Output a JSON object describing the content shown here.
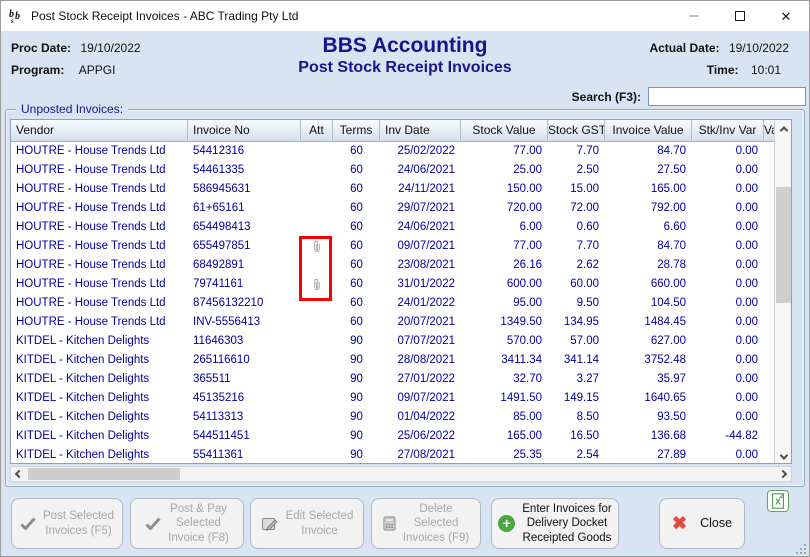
{
  "window": {
    "title": "Post Stock Receipt Invoices - ABC Trading Pty Ltd"
  },
  "header": {
    "proc_date_label": "Proc Date:",
    "proc_date": "19/10/2022",
    "program_label": "Program:",
    "program": "APPGI",
    "app_title": "BBS Accounting",
    "screen_title": "Post Stock Receipt Invoices",
    "actual_date_label": "Actual Date:",
    "actual_date": "19/10/2022",
    "time_label": "Time:",
    "time": "10:01",
    "search_label": "Search (F3):",
    "search_value": ""
  },
  "grid": {
    "group_label": "Unposted Invoices:",
    "columns": [
      "Vendor",
      "Invoice No",
      "Att",
      "Terms",
      "Inv Date",
      "Stock Value",
      "Stock GST",
      "Invoice Value",
      "Stk/Inv Var",
      "Va"
    ],
    "rows": [
      {
        "vendor": "HOUTRE - House Trends Ltd",
        "invoice_no": "54412316",
        "att": false,
        "terms": "60",
        "inv_date": "25/02/2022",
        "stock_value": "77.00",
        "stock_gst": "7.70",
        "invoice_value": "84.70",
        "stk_inv_var": "0.00"
      },
      {
        "vendor": "HOUTRE - House Trends Ltd",
        "invoice_no": "54461335",
        "att": false,
        "terms": "60",
        "inv_date": "24/06/2021",
        "stock_value": "25.00",
        "stock_gst": "2.50",
        "invoice_value": "27.50",
        "stk_inv_var": "0.00"
      },
      {
        "vendor": "HOUTRE - House Trends Ltd",
        "invoice_no": "586945631",
        "att": false,
        "terms": "60",
        "inv_date": "24/11/2021",
        "stock_value": "150.00",
        "stock_gst": "15.00",
        "invoice_value": "165.00",
        "stk_inv_var": "0.00"
      },
      {
        "vendor": "HOUTRE - House Trends Ltd",
        "invoice_no": "61+65161",
        "att": false,
        "terms": "60",
        "inv_date": "29/07/2021",
        "stock_value": "720.00",
        "stock_gst": "72.00",
        "invoice_value": "792.00",
        "stk_inv_var": "0.00"
      },
      {
        "vendor": "HOUTRE - House Trends Ltd",
        "invoice_no": "654498413",
        "att": false,
        "terms": "60",
        "inv_date": "24/06/2021",
        "stock_value": "6.00",
        "stock_gst": "0.60",
        "invoice_value": "6.60",
        "stk_inv_var": "0.00"
      },
      {
        "vendor": "HOUTRE - House Trends Ltd",
        "invoice_no": "655497851",
        "att": true,
        "terms": "60",
        "inv_date": "09/07/2021",
        "stock_value": "77.00",
        "stock_gst": "7.70",
        "invoice_value": "84.70",
        "stk_inv_var": "0.00"
      },
      {
        "vendor": "HOUTRE - House Trends Ltd",
        "invoice_no": "68492891",
        "att": false,
        "terms": "60",
        "inv_date": "23/08/2021",
        "stock_value": "26.16",
        "stock_gst": "2.62",
        "invoice_value": "28.78",
        "stk_inv_var": "0.00"
      },
      {
        "vendor": "HOUTRE - House Trends Ltd",
        "invoice_no": "79741161",
        "att": true,
        "terms": "60",
        "inv_date": "31/01/2022",
        "stock_value": "600.00",
        "stock_gst": "60.00",
        "invoice_value": "660.00",
        "stk_inv_var": "0.00"
      },
      {
        "vendor": "HOUTRE - House Trends Ltd",
        "invoice_no": "87456132210",
        "att": false,
        "terms": "60",
        "inv_date": "24/01/2022",
        "stock_value": "95.00",
        "stock_gst": "9.50",
        "invoice_value": "104.50",
        "stk_inv_var": "0.00"
      },
      {
        "vendor": "HOUTRE - House Trends Ltd",
        "invoice_no": "INV-5556413",
        "att": false,
        "terms": "60",
        "inv_date": "20/07/2021",
        "stock_value": "1349.50",
        "stock_gst": "134.95",
        "invoice_value": "1484.45",
        "stk_inv_var": "0.00"
      },
      {
        "vendor": "KITDEL - Kitchen Delights",
        "invoice_no": "11646303",
        "att": false,
        "terms": "90",
        "inv_date": "07/07/2021",
        "stock_value": "570.00",
        "stock_gst": "57.00",
        "invoice_value": "627.00",
        "stk_inv_var": "0.00"
      },
      {
        "vendor": "KITDEL - Kitchen Delights",
        "invoice_no": "265116610",
        "att": false,
        "terms": "90",
        "inv_date": "28/08/2021",
        "stock_value": "3411.34",
        "stock_gst": "341.14",
        "invoice_value": "3752.48",
        "stk_inv_var": "0.00"
      },
      {
        "vendor": "KITDEL - Kitchen Delights",
        "invoice_no": "365511",
        "att": false,
        "terms": "90",
        "inv_date": "27/01/2022",
        "stock_value": "32.70",
        "stock_gst": "3.27",
        "invoice_value": "35.97",
        "stk_inv_var": "0.00"
      },
      {
        "vendor": "KITDEL - Kitchen Delights",
        "invoice_no": "45135216",
        "att": false,
        "terms": "90",
        "inv_date": "09/07/2021",
        "stock_value": "1491.50",
        "stock_gst": "149.15",
        "invoice_value": "1640.65",
        "stk_inv_var": "0.00"
      },
      {
        "vendor": "KITDEL - Kitchen Delights",
        "invoice_no": "54113313",
        "att": false,
        "terms": "90",
        "inv_date": "01/04/2022",
        "stock_value": "85.00",
        "stock_gst": "8.50",
        "invoice_value": "93.50",
        "stk_inv_var": "0.00"
      },
      {
        "vendor": "KITDEL - Kitchen Delights",
        "invoice_no": "544511451",
        "att": false,
        "terms": "90",
        "inv_date": "25/06/2022",
        "stock_value": "165.00",
        "stock_gst": "16.50",
        "invoice_value": "136.68",
        "stk_inv_var": "-44.82"
      },
      {
        "vendor": "KITDEL - Kitchen Delights",
        "invoice_no": "55411361",
        "att": false,
        "terms": "90",
        "inv_date": "27/08/2021",
        "stock_value": "25.35",
        "stock_gst": "2.54",
        "invoice_value": "27.89",
        "stk_inv_var": "0.00"
      }
    ]
  },
  "buttons": [
    {
      "label": "Post Selected\nInvoices (F5)",
      "enabled": false
    },
    {
      "label": "Post & Pay\nSelected\nInvoice (F8)",
      "enabled": false
    },
    {
      "label": "Edit Selected\nInvoice",
      "enabled": false
    },
    {
      "label": "Delete\nSelected\nInvoices (F9)",
      "enabled": false
    },
    {
      "label": "Enter Invoices for\nDelivery Docket\nReceipted Goods",
      "enabled": true
    },
    {
      "label": "Close",
      "enabled": true
    }
  ],
  "colors": {
    "title_navy": "#15158d",
    "grid_text_blue": "#0000a0",
    "annotation_red": "#f40000",
    "close_x_red": "#dd4a3f",
    "plus_green": "#4aa83e",
    "excel_green": "#3f9b3f",
    "body_background": "#d9e4f2"
  }
}
